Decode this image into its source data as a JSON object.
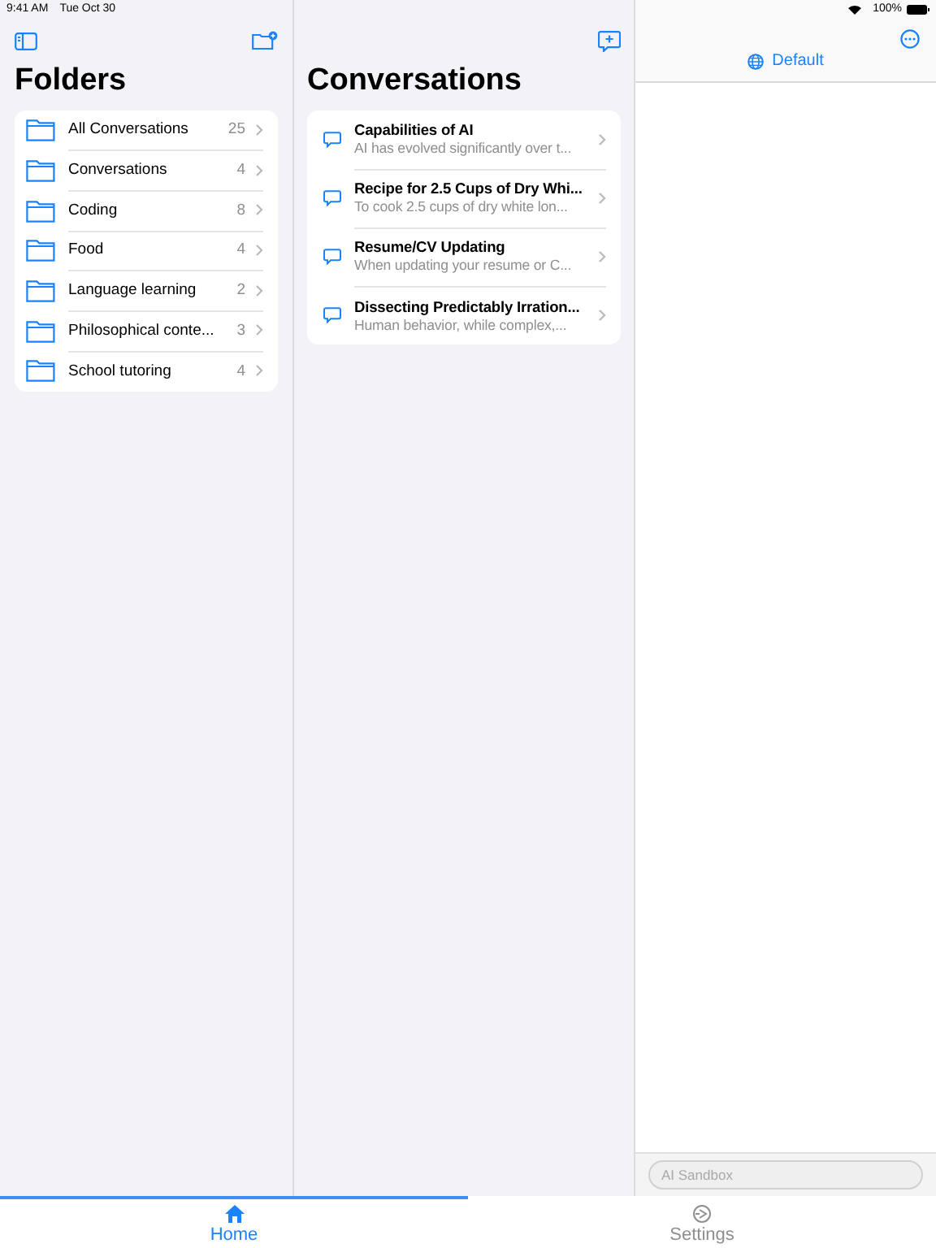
{
  "status_bar": {
    "time": "9:41 AM",
    "date": "Tue Oct 30",
    "battery": "100%"
  },
  "folders": {
    "title": "Folders",
    "items": [
      {
        "name": "All Conversations",
        "count": "25"
      },
      {
        "name": "Conversations",
        "count": "4"
      },
      {
        "name": "Coding",
        "count": "8"
      },
      {
        "name": "Food",
        "count": "4"
      },
      {
        "name": "Language learning",
        "count": "2"
      },
      {
        "name": "Philosophical conte...",
        "count": "3"
      },
      {
        "name": "School tutoring",
        "count": "4"
      }
    ]
  },
  "conversations": {
    "title": "Conversations",
    "items": [
      {
        "title": "Capabilities of AI",
        "preview": "AI has evolved significantly over t..."
      },
      {
        "title": "Recipe for 2.5 Cups of Dry Whi...",
        "preview": "To cook 2.5 cups of dry white lon..."
      },
      {
        "title": "Resume/CV Updating",
        "preview": "When updating your resume or C..."
      },
      {
        "title": "Dissecting Predictably Irration...",
        "preview": "Human behavior, while complex,..."
      }
    ]
  },
  "detail": {
    "mode": "Default",
    "input": {
      "placeholder": "AI Sandbox"
    }
  },
  "tabs": [
    {
      "kind": "home",
      "label": "Home",
      "selected": true
    },
    {
      "kind": "settings",
      "label": "Settings",
      "selected": false
    }
  ]
}
